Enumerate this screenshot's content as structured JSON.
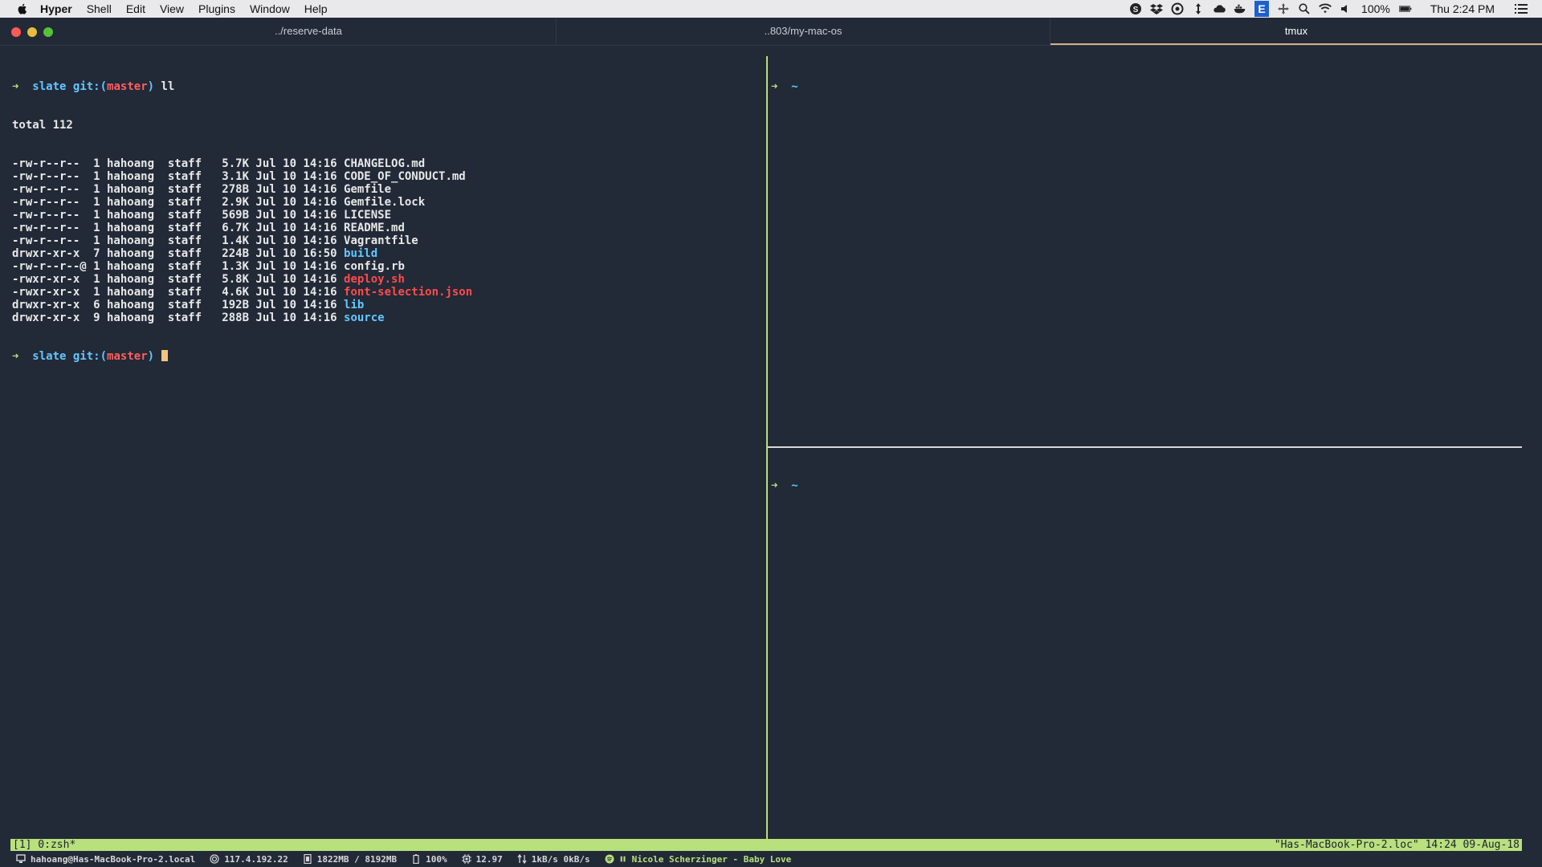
{
  "menubar": {
    "app_name": "Hyper",
    "items": [
      "Shell",
      "Edit",
      "View",
      "Plugins",
      "Window",
      "Help"
    ],
    "battery": "100%",
    "clock": "Thu 2:24 PM",
    "edit_badge": "E"
  },
  "tabs": [
    {
      "label": "../reserve-data",
      "active": false
    },
    {
      "label": "..803/my-mac-os",
      "active": false
    },
    {
      "label": "tmux",
      "active": true
    }
  ],
  "left_pane": {
    "prompt_arrow": "➜",
    "prompt_dir": "slate",
    "prompt_git_open": "git:(",
    "prompt_branch": "master",
    "prompt_git_close": ")",
    "command": "ll",
    "total": "total 112",
    "listing": [
      {
        "perms": "-rw-r--r--  1 hahoang  staff   5.7K Jul 10 14:16 ",
        "name": "CHANGELOG.md",
        "kind": "file"
      },
      {
        "perms": "-rw-r--r--  1 hahoang  staff   3.1K Jul 10 14:16 ",
        "name": "CODE_OF_CONDUCT.md",
        "kind": "file"
      },
      {
        "perms": "-rw-r--r--  1 hahoang  staff   278B Jul 10 14:16 ",
        "name": "Gemfile",
        "kind": "file"
      },
      {
        "perms": "-rw-r--r--  1 hahoang  staff   2.9K Jul 10 14:16 ",
        "name": "Gemfile.lock",
        "kind": "file"
      },
      {
        "perms": "-rw-r--r--  1 hahoang  staff   569B Jul 10 14:16 ",
        "name": "LICENSE",
        "kind": "file"
      },
      {
        "perms": "-rw-r--r--  1 hahoang  staff   6.7K Jul 10 14:16 ",
        "name": "README.md",
        "kind": "file"
      },
      {
        "perms": "-rw-r--r--  1 hahoang  staff   1.4K Jul 10 14:16 ",
        "name": "Vagrantfile",
        "kind": "file"
      },
      {
        "perms": "drwxr-xr-x  7 hahoang  staff   224B Jul 10 16:50 ",
        "name": "build",
        "kind": "dir"
      },
      {
        "perms": "-rw-r--r--@ 1 hahoang  staff   1.3K Jul 10 14:16 ",
        "name": "config.rb",
        "kind": "file"
      },
      {
        "perms": "-rwxr-xr-x  1 hahoang  staff   5.8K Jul 10 14:16 ",
        "name": "deploy.sh",
        "kind": "exec"
      },
      {
        "perms": "-rwxr-xr-x  1 hahoang  staff   4.6K Jul 10 14:16 ",
        "name": "font-selection.json",
        "kind": "exec"
      },
      {
        "perms": "drwxr-xr-x  6 hahoang  staff   192B Jul 10 14:16 ",
        "name": "lib",
        "kind": "dir"
      },
      {
        "perms": "drwxr-xr-x  9 hahoang  staff   288B Jul 10 14:16 ",
        "name": "source",
        "kind": "dir"
      }
    ]
  },
  "right_panes": {
    "top_prompt": "~",
    "bottom_prompt": "~",
    "arrow": "➜"
  },
  "tmux": {
    "left": "[1] 0:zsh*",
    "right": "\"Has-MacBook-Pro-2.loc\" 14:24 09-Aug-18"
  },
  "stats": {
    "host": "hahoang@Has-MacBook-Pro-2.local",
    "ip": "117.4.192.22",
    "memory": "1822MB / 8192MB",
    "battery": "100%",
    "cpu": "12.97",
    "network": "1kB/s 0kB/s",
    "music": "Nicole Scherzinger - Baby Love"
  },
  "colors": {
    "background": "#222937",
    "accent_green": "#b8e07c",
    "prompt_blue": "#62c8ff",
    "branch_red": "#ff5f5f",
    "cursor": "#f3c57e"
  }
}
